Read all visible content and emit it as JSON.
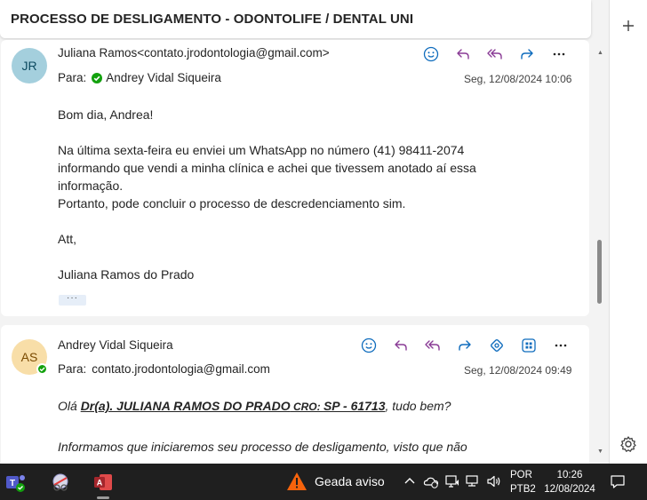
{
  "subject": "PROCESSO DE DESLIGAMENTO - ODONTOLIFE / DENTAL UNI",
  "messages": [
    {
      "avatar_initials": "JR",
      "from": "Juliana Ramos<contato.jrodontologia@gmail.com>",
      "to_label": "Para:",
      "to": "Andrey Vidal Siqueira",
      "date": "Seg, 12/08/2024 10:06",
      "body": {
        "greeting": "Bom dia, Andrea!",
        "line1": "Na última sexta-feira eu enviei um WhatsApp no número (41) 98411-2074",
        "line2": "informando que vendi a minha clínica e achei que tivessem anotado aí essa",
        "line3": "informação.",
        "line4": "Portanto, pode concluir o processo de descredenciamento sim.",
        "closing": "Att,",
        "signature": "Juliana Ramos do Prado"
      },
      "show_more": "···"
    },
    {
      "avatar_initials": "AS",
      "from": "Andrey Vidal Siqueira",
      "to_label": "Para:",
      "to": "contato.jrodontologia@gmail.com",
      "date": "Seg, 12/08/2024 09:49",
      "body": {
        "hello": "Olá ",
        "name": "Dr(a). JULIANA RAMOS DO PRADO",
        "cro": " CRO: ",
        "cro_num": "SP - 61713",
        "tail": ", tudo bem?",
        "line2": "Informamos que iniciaremos seu processo de desligamento, visto que não"
      }
    }
  ],
  "taskbar": {
    "weather_text": "Geada aviso",
    "lang_top": "POR",
    "lang_bottom": "PTB2",
    "time": "10:26",
    "date": "12/08/2024"
  },
  "colors": {
    "accent": "#0f6cbd",
    "reply_purple": "#8a3c96",
    "presence_green": "#13a10e",
    "taskbar": "#1f1f1f"
  }
}
